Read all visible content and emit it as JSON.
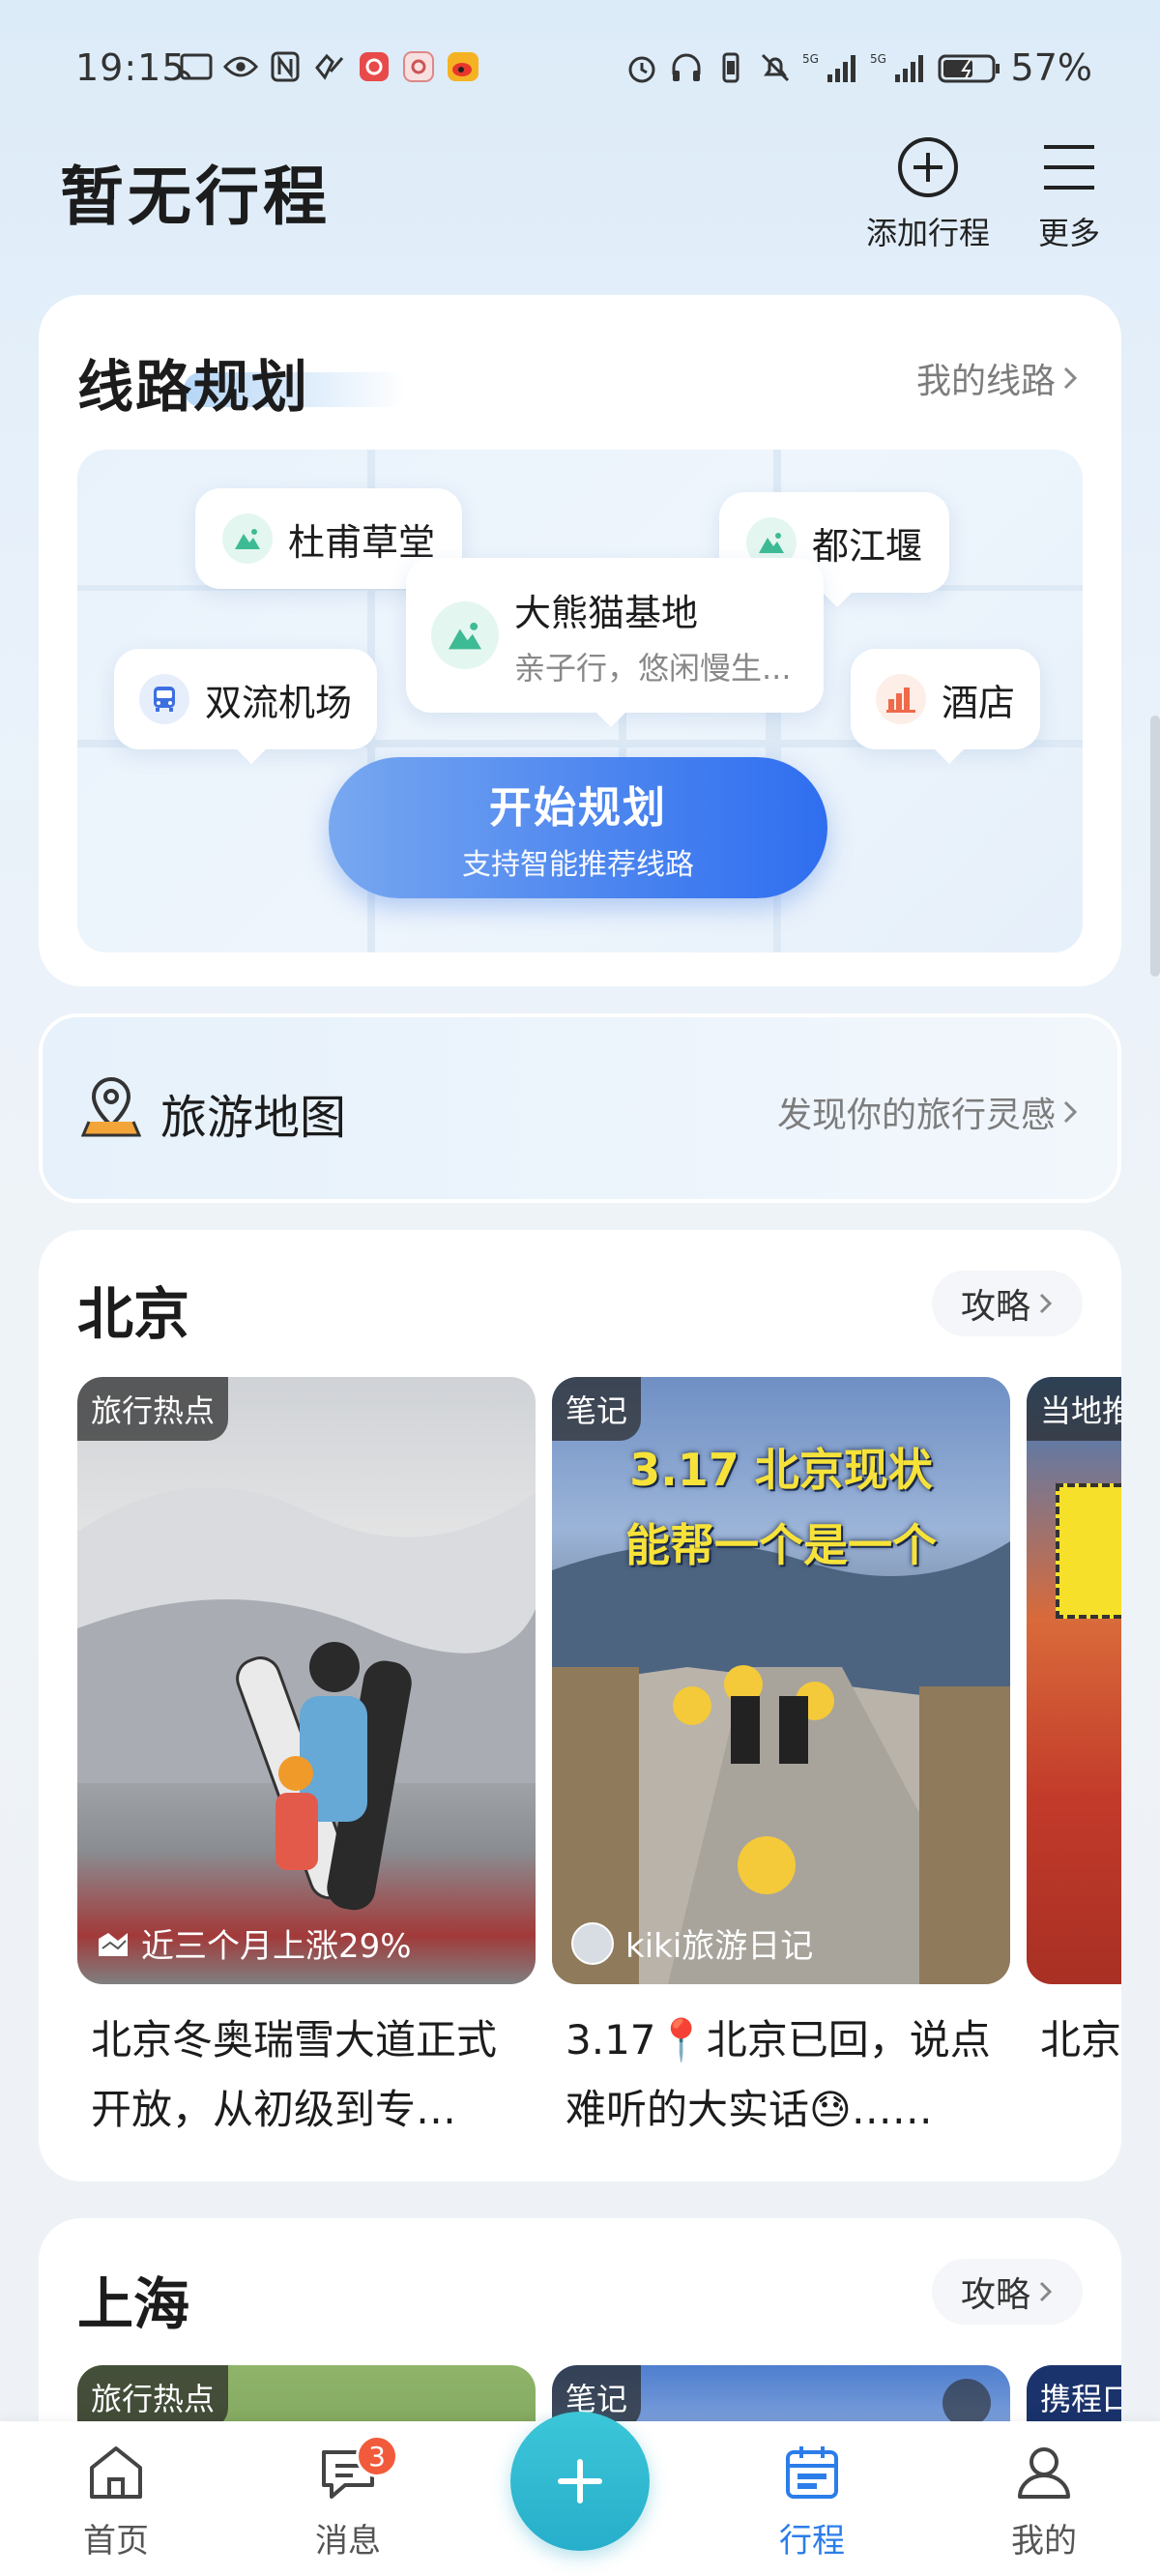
{
  "status_bar": {
    "time": "19:15",
    "battery": "57%",
    "network_1": "5G",
    "network_2": "5G"
  },
  "header": {
    "title": "暂无行程",
    "add_trip_label": "添加行程",
    "more_label": "更多"
  },
  "route_planning": {
    "title": "线路规划",
    "my_routes": "我的线路",
    "pois": [
      {
        "name": "杜甫草堂",
        "icon": "mountain-icon"
      },
      {
        "name": "都江堰",
        "icon": "mountain-icon"
      },
      {
        "name": "大熊猫基地",
        "subtitle": "亲子行，悠闲慢生...",
        "icon": "mountain-icon"
      },
      {
        "name": "双流机场",
        "icon": "bus-icon"
      },
      {
        "name": "酒店",
        "icon": "hotel-icon"
      }
    ],
    "start_button": "开始规划",
    "start_button_sub": "支持智能推荐线路"
  },
  "travel_map": {
    "title": "旅游地图",
    "link": "发现你的旅行灵感"
  },
  "cities": [
    {
      "name": "北京",
      "guide": "攻略",
      "posts": [
        {
          "tag": "旅行热点",
          "overlay": "近三个月上涨29%",
          "caption": "北京冬奥瑞雪大道正式开放，从初级到专…"
        },
        {
          "tag": "笔记",
          "image_text_1": "3.17 北京现状",
          "image_text_2": "能帮一个是一个",
          "overlay": "kiki旅游日记",
          "caption": "3.17📍北京已回，说点难听的大实话😓……"
        },
        {
          "tag": "当地推",
          "caption": "北京够！"
        }
      ]
    },
    {
      "name": "上海",
      "guide": "攻略",
      "posts": [
        {
          "tag": "旅行热点"
        },
        {
          "tag": "笔记"
        },
        {
          "tag": "携程口"
        }
      ]
    }
  ],
  "bottom_nav": {
    "home": "首页",
    "messages": "消息",
    "messages_badge": "3",
    "trips": "行程",
    "mine": "我的"
  },
  "colors": {
    "accent_blue": "#2b7de9",
    "add_button": "#27aecb",
    "badge": "#f25a3c"
  }
}
